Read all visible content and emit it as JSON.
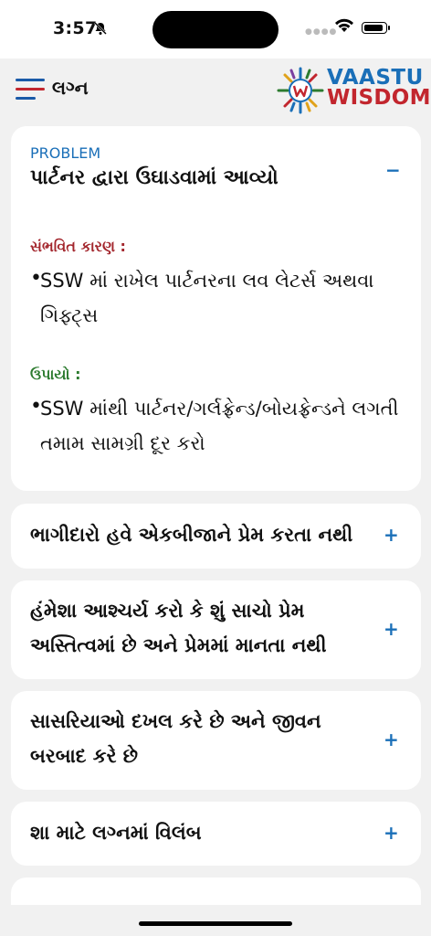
{
  "status": {
    "time": "3:57"
  },
  "header": {
    "title": "લગ્ન",
    "logo_line1": "VAASTU",
    "logo_line2": "WISDOM"
  },
  "expanded": {
    "tag": "PROBLEM",
    "title": "પાર્ટનર દ્વારા ઉઘાડવામાં આવ્યો",
    "toggle": "−",
    "cause_label": "સંભવિત કારણ :",
    "cause_text": "SSW માં રાખેલ પાર્ટનરના લવ લેટર્સ અથવા ગિફ્ટ્સ",
    "remedy_label": "ઉપાયો :",
    "remedy_text": "SSW માંથી પાર્ટનર/ગર્લફ્રેન્ડ/બોયફ્રેન્ડને લગતી તમામ સામગ્રી દૂર કરો",
    "bullet": "•"
  },
  "items": [
    {
      "title": "ભાગીદારો હવે એકબીજાને પ્રેમ કરતા નથી",
      "toggle": "+"
    },
    {
      "title": "હંમેશા આશ્ચર્ય કરો કે શું સાચો પ્રેમ અસ્તિત્વમાં છે અને પ્રેમમાં માનતા નથી",
      "toggle": "+"
    },
    {
      "title": "સાસરિયાઓ દખલ કરે છે અને જીવન બરબાદ કરે છે",
      "toggle": "+"
    },
    {
      "title": "શા માટે લગ્નમાં વિલંબ",
      "toggle": "+"
    }
  ]
}
